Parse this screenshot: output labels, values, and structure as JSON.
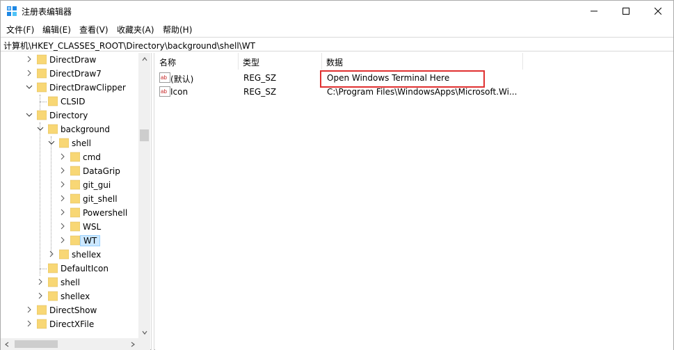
{
  "window": {
    "title": "注册表编辑器",
    "icon": "registry-editor-icon"
  },
  "menu": [
    {
      "label": "文件(F)"
    },
    {
      "label": "编辑(E)"
    },
    {
      "label": "查看(V)"
    },
    {
      "label": "收藏夹(A)"
    },
    {
      "label": "帮助(H)"
    }
  ],
  "address": {
    "path": "计算机\\HKEY_CLASSES_ROOT\\Directory\\background\\shell\\WT"
  },
  "tree": {
    "items": [
      {
        "label": "DirectDraw",
        "state": "collapsed"
      },
      {
        "label": "DirectDraw7",
        "state": "collapsed"
      },
      {
        "label": "DirectDrawClipper",
        "state": "expanded"
      },
      {
        "label": "CLSID",
        "state": "leaf"
      },
      {
        "label": "Directory",
        "state": "expanded"
      },
      {
        "label": "background",
        "state": "expanded"
      },
      {
        "label": "shell",
        "state": "expanded"
      },
      {
        "label": "cmd",
        "state": "collapsed"
      },
      {
        "label": "DataGrip",
        "state": "collapsed"
      },
      {
        "label": "git_gui",
        "state": "collapsed"
      },
      {
        "label": "git_shell",
        "state": "collapsed"
      },
      {
        "label": "Powershell",
        "state": "collapsed"
      },
      {
        "label": "WSL",
        "state": "collapsed"
      },
      {
        "label": "WT",
        "state": "selected"
      },
      {
        "label": "shellex",
        "state": "collapsed"
      },
      {
        "label": "DefaultIcon",
        "state": "leaf"
      },
      {
        "label": "shell",
        "state": "collapsed"
      },
      {
        "label": "shellex",
        "state": "collapsed"
      },
      {
        "label": "DirectShow",
        "state": "collapsed"
      },
      {
        "label": "DirectXFile",
        "state": "collapsed"
      }
    ]
  },
  "values": {
    "columns": [
      "名称",
      "类型",
      "数据"
    ],
    "rows": [
      {
        "name": "(默认)",
        "type": "REG_SZ",
        "data": "Open Windows Terminal Here"
      },
      {
        "name": "Icon",
        "type": "REG_SZ",
        "data": "C:\\Program Files\\WindowsApps\\Microsoft.Wi..."
      }
    ],
    "highlight_color": "#e03030"
  },
  "colors": {
    "selection": "#cce8ff",
    "folder": "#f8d775"
  }
}
